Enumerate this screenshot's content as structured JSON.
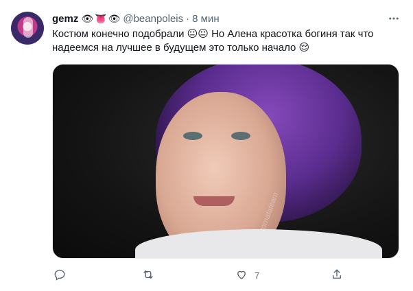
{
  "tweet": {
    "author_name": "gemz",
    "name_emojis": [
      "👁",
      "👅",
      "👁"
    ],
    "handle": "@beanpoleis",
    "separator": "·",
    "time": "8 мин",
    "text": "Костюм конечно подобрали 😐😐 Но Алена красотка богиня так что надеемся на лучшее в будущем это только начало 😌",
    "more_icon": "more-horizontal-icon",
    "media": {
      "kind": "photo",
      "watermark": "tornatateam"
    },
    "actions": {
      "reply": {
        "icon": "reply-icon",
        "count": ""
      },
      "retweet": {
        "icon": "retweet-icon",
        "count": ""
      },
      "like": {
        "icon": "heart-icon",
        "count": "7"
      },
      "share": {
        "icon": "share-icon",
        "count": ""
      }
    }
  },
  "colors": {
    "text_primary": "#0f1419",
    "text_secondary": "#536471",
    "background": "#ffffff",
    "hair_purple": "#6f3aa8"
  }
}
